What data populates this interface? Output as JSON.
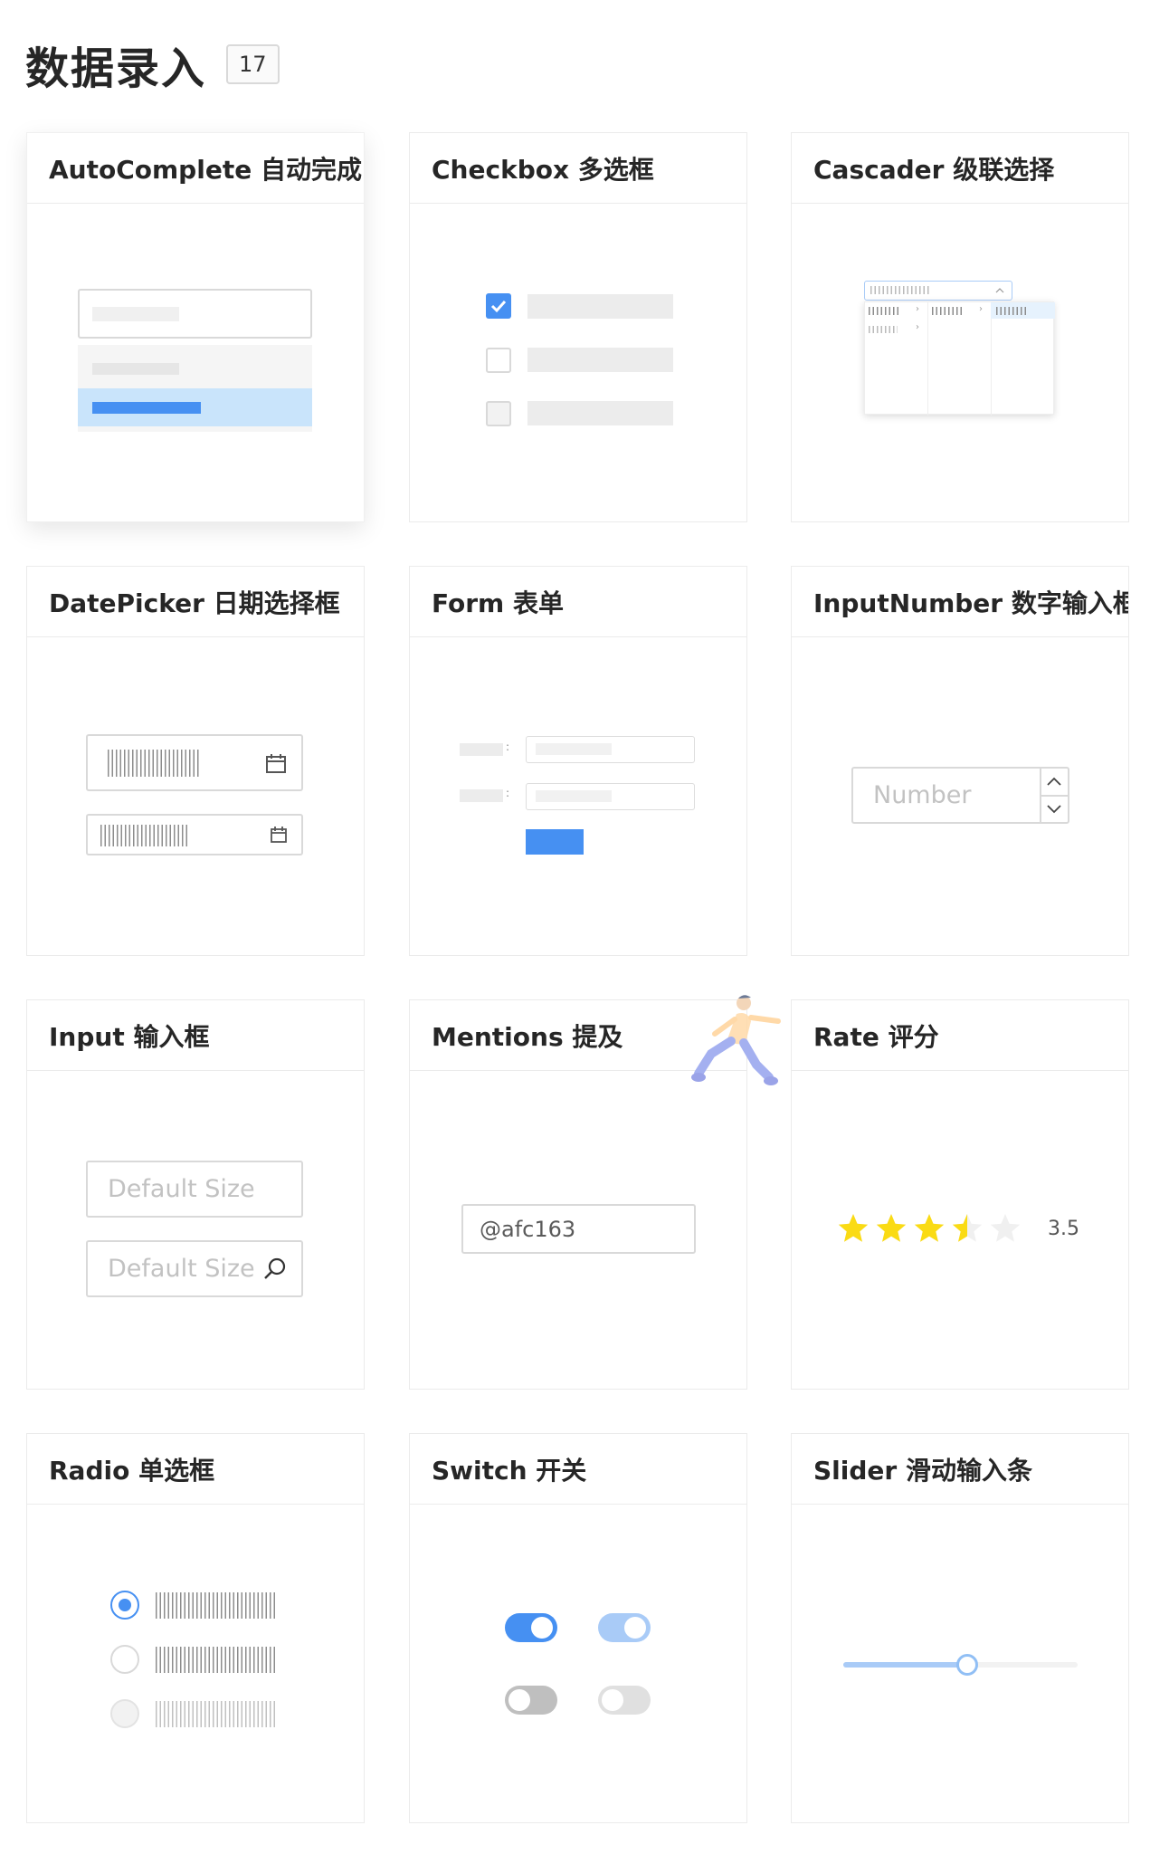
{
  "page": {
    "title": "数据录入",
    "count": "17"
  },
  "cards": {
    "autocomplete": {
      "title": "AutoComplete 自动完成"
    },
    "checkbox": {
      "title": "Checkbox 多选框"
    },
    "cascader": {
      "title": "Cascader 级联选择"
    },
    "datepicker": {
      "title": "DatePicker 日期选择框"
    },
    "form": {
      "title": "Form 表单"
    },
    "inputnumber": {
      "title": "InputNumber 数字输入框",
      "placeholder": "Number"
    },
    "input": {
      "title": "Input 输入框",
      "placeholder_1": "Default Size",
      "placeholder_2": "Default Size"
    },
    "mentions": {
      "title": "Mentions 提及",
      "value": "@afc163"
    },
    "rate": {
      "title": "Rate 评分",
      "value": "3.5",
      "max": 5
    },
    "radio": {
      "title": "Radio 单选框"
    },
    "switch": {
      "title": "Switch 开关"
    },
    "slider": {
      "title": "Slider 滑动输入条",
      "value_fraction": 0.53
    }
  },
  "colors": {
    "primary": "#4690f2",
    "primary_light": "#a9cbf7",
    "selected_bg": "#c9e4fb",
    "star": "#fadb14",
    "border": "#d9d9d9"
  },
  "icons": [
    "calendar-icon",
    "search-icon",
    "chevron-up-icon",
    "chevron-down-icon",
    "check-icon",
    "star-icon",
    "mascot-illustration"
  ]
}
